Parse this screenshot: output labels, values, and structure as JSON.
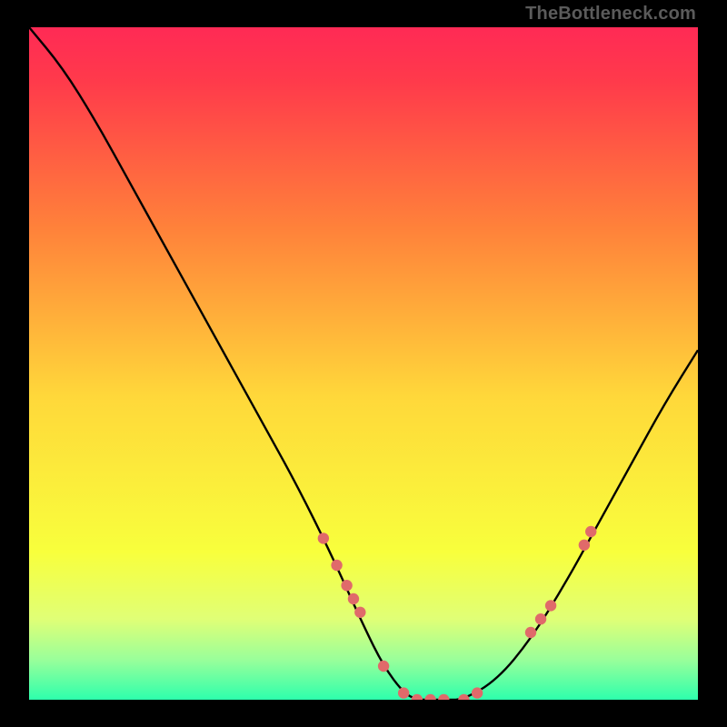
{
  "watermark": "TheBottleneck.com",
  "chart_data": {
    "type": "line",
    "title": "",
    "xlabel": "",
    "ylabel": "",
    "xlim": [
      0,
      100
    ],
    "ylim": [
      0,
      100
    ],
    "grid": false,
    "gradient_background": {
      "stops": [
        {
          "offset": 0.0,
          "color": "#ff2a55"
        },
        {
          "offset": 0.08,
          "color": "#ff3a4b"
        },
        {
          "offset": 0.3,
          "color": "#ff823a"
        },
        {
          "offset": 0.55,
          "color": "#ffd83a"
        },
        {
          "offset": 0.78,
          "color": "#f8ff3c"
        },
        {
          "offset": 0.88,
          "color": "#e0ff76"
        },
        {
          "offset": 0.94,
          "color": "#9aff9a"
        },
        {
          "offset": 1.0,
          "color": "#2dffac"
        }
      ]
    },
    "series": [
      {
        "name": "bottleneck-curve",
        "type": "line",
        "color": "#000000",
        "x": [
          0,
          5,
          10,
          15,
          20,
          25,
          30,
          35,
          40,
          45,
          50,
          53,
          56,
          58,
          60,
          62,
          65,
          70,
          75,
          80,
          85,
          90,
          95,
          100
        ],
        "y": [
          100,
          94,
          86,
          77,
          68,
          59,
          50,
          41,
          32,
          22,
          11,
          5,
          1,
          0,
          0,
          0,
          0,
          3,
          9,
          17,
          26,
          35,
          44,
          52
        ]
      },
      {
        "name": "highlight-points",
        "type": "scatter",
        "color": "#e06a6a",
        "x": [
          44,
          46,
          47.5,
          48.5,
          49.5,
          53,
          56,
          58,
          60,
          62,
          65,
          67,
          75,
          76.5,
          78,
          83,
          84
        ],
        "y": [
          24,
          20,
          17,
          15,
          13,
          5,
          1,
          0,
          0,
          0,
          0,
          1,
          10,
          12,
          14,
          23,
          25
        ]
      }
    ]
  }
}
